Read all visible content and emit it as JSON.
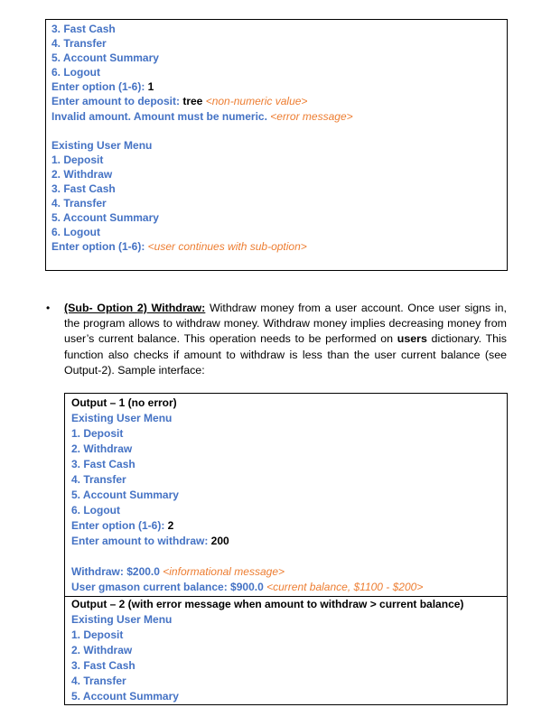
{
  "colors": {
    "prompt": "#4472c4",
    "note": "#ed7d31",
    "value": "#000000"
  },
  "box1": {
    "lines": [
      {
        "t": "3. Fast Cash"
      },
      {
        "t": "4. Transfer"
      },
      {
        "t": "5. Account Summary"
      },
      {
        "t": "6. Logout"
      },
      {
        "t": "Enter option (1-6): ",
        "v": "1"
      },
      {
        "t": "Enter amount to deposit: ",
        "v": "tree",
        "n": " <non-numeric value>"
      },
      {
        "t": "Invalid amount. Amount must be numeric.",
        "n": " <error message>"
      },
      {
        "t": ""
      },
      {
        "t": "Existing User Menu"
      },
      {
        "t": "1. Deposit"
      },
      {
        "t": "2. Withdraw"
      },
      {
        "t": "3. Fast Cash"
      },
      {
        "t": "4. Transfer"
      },
      {
        "t": "5. Account Summary"
      },
      {
        "t": "6. Logout"
      },
      {
        "t": "Enter option (1-6): ",
        "n": "<user continues with sub-option>"
      }
    ]
  },
  "paragraph": {
    "bullet": "•",
    "lead": "(Sub- Option 2) Withdraw:",
    "text1": " Withdraw money from a user account. Once user signs in, the program allows to withdraw money. Withdraw money implies decreasing money from user’s current balance. This operation needs to be performed on ",
    "bold": "users",
    "text2": " dictionary. This function also checks if amount to withdraw is less than the user current balance (see Output-2). Sample interface:"
  },
  "box2": {
    "lines": [
      {
        "h": "Output – 1 (no error)"
      },
      {
        "t": "Existing User Menu"
      },
      {
        "t": "1. Deposit"
      },
      {
        "t": "2. Withdraw"
      },
      {
        "t": "3. Fast Cash"
      },
      {
        "t": "4. Transfer"
      },
      {
        "t": "5. Account Summary"
      },
      {
        "t": "6. Logout"
      },
      {
        "t": "Enter option (1-6): ",
        "v": "2"
      },
      {
        "t": "Enter amount to withdraw: ",
        "v": "200"
      },
      {
        "t": ""
      },
      {
        "t": "Withdraw: $200.0",
        "n": " <informational message>"
      },
      {
        "t": "User gmason current balance: $900.0",
        "n": "  <current balance, $1100 - $200>"
      }
    ]
  },
  "box3": {
    "lines": [
      {
        "h": "Output – 2 (with error message when amount to withdraw > current balance)"
      },
      {
        "t": "Existing User Menu"
      },
      {
        "t": "1. Deposit"
      },
      {
        "t": "2. Withdraw"
      },
      {
        "t": "3. Fast Cash"
      },
      {
        "t": "4. Transfer"
      },
      {
        "t": "5. Account Summary"
      }
    ]
  }
}
